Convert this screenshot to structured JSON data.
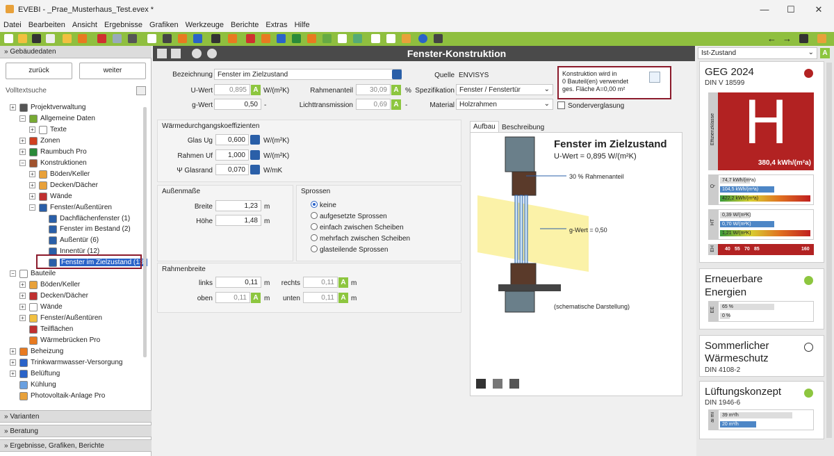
{
  "window": {
    "title": "EVEBI  -  _Prae_Musterhaus_Test.evex *",
    "min": "—",
    "max": "☐",
    "close": "✕"
  },
  "menu": [
    "Datei",
    "Bearbeiten",
    "Ansicht",
    "Ergebnisse",
    "Grafiken",
    "Werkzeuge",
    "Berichte",
    "Extras",
    "Hilfe"
  ],
  "toolbar": {
    "back": "←",
    "forward": "→"
  },
  "left": {
    "header": "Gebäudedaten",
    "back_btn": "zurück",
    "next_btn": "weiter",
    "search_label": "Volltextsuche",
    "tree": [
      "Projektverwaltung",
      "Allgemeine Daten",
      "Texte",
      "Zonen",
      "Raumbuch Pro",
      "Konstruktionen",
      "Böden/Keller",
      "Decken/Dächer",
      "Wände",
      "Fenster/Außentüren",
      "Dachflächenfenster (1)",
      "Fenster im Bestand (2)",
      "Außentür (6)",
      "Innentür (12)",
      "Fenster im Zielzustand (13)",
      "Bauteile",
      "Böden/Keller",
      "Decken/Dächer",
      "Wände",
      "Fenster/Außentüren",
      "Teilflächen",
      "Wärmebrücken Pro",
      "Beheizung",
      "Trinkwarmwasser-Versorgung",
      "Belüftung",
      "Kühlung",
      "Photovoltaik-Anlage Pro"
    ],
    "footers": [
      "Varianten",
      "Beratung",
      "Ergebnisse, Grafiken, Berichte"
    ]
  },
  "main": {
    "title": "Fenster-Konstruktion",
    "bezeichnung_label": "Bezeichnung",
    "bezeichnung": "Fenster im Zielzustand",
    "uwert_label": "U-Wert",
    "uwert": "0,895",
    "uwert_unit": "W/(m²K)",
    "gwert_label": "g-Wert",
    "gwert": "0,50",
    "gwert_unit": "-",
    "rahmenanteil_label": "Rahmenanteil",
    "rahmenanteil": "30,09",
    "rahmenanteil_unit": "%",
    "licht_label": "Lichttransmission",
    "licht": "0,69",
    "licht_unit": "-",
    "quelle_label": "Quelle",
    "quelle": "ENVISYS",
    "spez_label": "Spezifikation",
    "spez": "Fenster / Fenstertür",
    "material_label": "Material",
    "material": "Holzrahmen",
    "notice": [
      "Konstruktion wird in",
      "0 Bauteil(en) verwendet",
      "ges. Fläche A=0,00 m²"
    ],
    "sonder": "Sonderverglasung",
    "badge": "A",
    "koeff_title": "Wärmedurchgangskoeffizienten",
    "glas_label": "Glas Ug",
    "glas": "0,600",
    "glas_unit": "W/(m²K)",
    "rahmen_label": "Rahmen Uf",
    "rahmen": "1,000",
    "rahmen_unit": "W/(m²K)",
    "rand_label": "Ψ Glasrand",
    "rand": "0,070",
    "rand_unit": "W/mK",
    "aussen_title": "Außenmaße",
    "breite_label": "Breite",
    "breite": "1,23",
    "hoehe_label": "Höhe",
    "hoehe": "1,48",
    "m": "m",
    "sprossen_title": "Sprossen",
    "sprossen": [
      "keine",
      "aufgesetzte Sprossen",
      "einfach zwischen Scheiben",
      "mehrfach zwischen Scheiben",
      "glasteilende Sprossen"
    ],
    "rb_title": "Rahmenbreite",
    "links_label": "links",
    "links": "0,11",
    "rechts_label": "rechts",
    "rechts": "0,11",
    "oben_label": "oben",
    "oben": "0,11",
    "unten_label": "unten",
    "unten": "0,11",
    "tabs": [
      "Aufbau",
      "Beschreibung"
    ],
    "diagram": {
      "title": "Fenster im Zielzustand",
      "uwert": "U-Wert = 0,895 W/(m²K)",
      "rahmen": "30 % Rahmenanteil",
      "gwert": "g-Wert = 0,50",
      "note": "(schematische Darstellung)"
    }
  },
  "right": {
    "state": "Ist-Zustand",
    "geg": {
      "title": "GEG 2024",
      "sub": "DIN V 18599",
      "big": "H",
      "value": "380,4 kWh/(m²a)",
      "side": "Effizienzklasse",
      "q_label": "Q",
      "q_bars": [
        {
          "label": "74,7 kWh/(m²a)",
          "frac": 0.33
        },
        {
          "label": "104,5 kWh/(m²a)",
          "frac": 0.6
        },
        {
          "label": "422,2 kWh/(m²a)",
          "frac": 1.0
        }
      ],
      "h_label": "HT",
      "h_bars": [
        {
          "label": "0,39 W/(m²K)",
          "frac": 0.33
        },
        {
          "label": "0,70 W/(m²K)",
          "frac": 0.6
        },
        {
          "label": "1,21 W/(m²K)",
          "frac": 1.0
        }
      ],
      "eh_label": "EH",
      "eh": [
        "40",
        "55",
        "70",
        "85",
        "160"
      ]
    },
    "ee": {
      "title1": "Erneuerbare",
      "title2": "Energien",
      "side": "EE",
      "bars": [
        {
          "label": "65 %",
          "frac": 0.6
        },
        {
          "label": "0 %",
          "frac": 0.05
        }
      ]
    },
    "sw": {
      "title1": "Sommerlicher",
      "title2": "Wärmeschutz",
      "sub": "DIN 4108-2"
    },
    "lk": {
      "title": "Lüftungskonzept",
      "sub": "DIN 1946-6",
      "side": "ai mi",
      "bars": [
        {
          "label": "39 m³/h",
          "frac": 0.8
        },
        {
          "label": "20 m³/h",
          "frac": 0.4
        }
      ]
    }
  },
  "colors": {
    "accent": "#8dc63f",
    "header": "#4a4a4a",
    "geg_red": "#b22222",
    "green": "#8dc63f",
    "highlight": "#8b1a2b"
  }
}
